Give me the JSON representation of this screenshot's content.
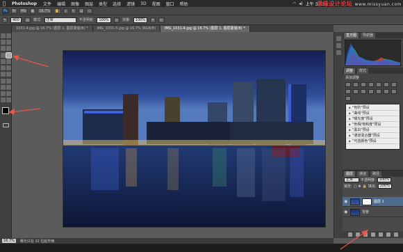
{
  "menubar": {
    "app_name": "Photoshop",
    "items": [
      "文件",
      "编辑",
      "图像",
      "图层",
      "类型",
      "选择",
      "滤镜",
      "3D",
      "视图",
      "窗口",
      "帮助"
    ],
    "clock": "上午 3:03"
  },
  "watermark": {
    "cn": "思缘设计论坛",
    "url": "www.missyuan.com"
  },
  "appbar": {
    "zoom": "16.7%"
  },
  "options": {
    "mode_label": "模式:",
    "mode_value": "正常",
    "opacity_label": "不透明度:",
    "opacity_value": "100%",
    "flow_label": "流量:",
    "flow_value": "100%",
    "size_value": "400"
  },
  "tabs": [
    {
      "label": "1031-4.jpg @ 16.7% (图层 1, 图层蒙版/8) *"
    },
    {
      "label": "IMG_1031-5.jpg @ 16.7% (RGB/8)"
    },
    {
      "label": "IMG_1031-4.jpg @ 16.7% (图层 1, 图层蒙版/8) *"
    }
  ],
  "status": {
    "zoom": "16.7%",
    "info": "曝光只在 32 位起作用"
  },
  "panels": {
    "histogram_tabs": [
      "直方图",
      "导航器"
    ],
    "adjust_tabs": [
      "调整",
      "样式"
    ],
    "adjust_title": "添加调整",
    "presets": [
      "\"色阶\"预设",
      "\"曲线\"预设",
      "\"曝光度\"预设",
      "\"色相/饱和度\"预设",
      "\"黑白\"预设",
      "\"通道混合器\"预设",
      "\"可选颜色\"预设"
    ],
    "layers_tabs": [
      "图层",
      "通道",
      "路径"
    ],
    "blend_mode": "正常",
    "opacity_label": "不透明度:",
    "opacity_value": "100%",
    "lock_label": "锁定:",
    "fill_label": "填充:",
    "fill_value": "100%",
    "layers": [
      {
        "name": "图层 1",
        "active": true,
        "mask": true
      },
      {
        "name": "背景",
        "active": false,
        "mask": false
      }
    ]
  },
  "colors": {
    "arrow": "#e8574c",
    "photo_sky_top": "#1c2a66",
    "photo_sky_bottom": "#3a5fa8",
    "layer_active": "#4d6a8e"
  }
}
